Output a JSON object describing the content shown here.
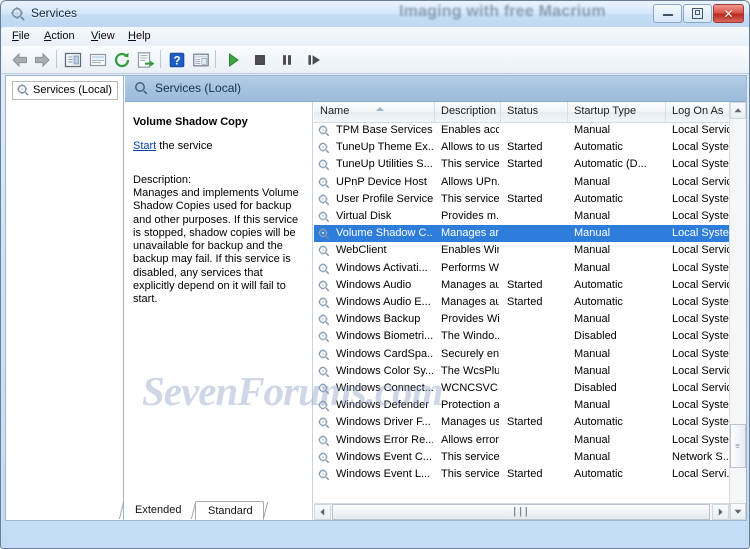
{
  "window": {
    "title": "Services",
    "title_icon": "services-gear-icon",
    "overlay_text": "Imaging with free Macrium",
    "watermark": "SevenForums.com",
    "controls": {
      "minimize": "minimize-button",
      "maximize": "maximize-button",
      "close": "close-button",
      "close_glyph": "✕"
    },
    "close_color": "#c43d2f",
    "accent_color": "#2f7ddb"
  },
  "menubar": {
    "items": [
      {
        "label": "File",
        "accel": "F"
      },
      {
        "label": "Action",
        "accel": "A"
      },
      {
        "label": "View",
        "accel": "V"
      },
      {
        "label": "Help",
        "accel": "H"
      }
    ]
  },
  "toolbar": {
    "buttons": [
      {
        "name": "back-button",
        "icon": "arrow-left-icon"
      },
      {
        "name": "forward-button",
        "icon": "arrow-right-icon"
      },
      {
        "name": "show-hide-tree-button",
        "icon": "tree-panel-icon"
      },
      {
        "name": "properties-button",
        "icon": "properties-icon"
      },
      {
        "name": "refresh-button",
        "icon": "refresh-icon"
      },
      {
        "name": "export-list-button",
        "icon": "export-icon"
      },
      {
        "name": "help-button",
        "icon": "question-mark-icon"
      },
      {
        "name": "new-window-button",
        "icon": "new-window-icon"
      },
      {
        "name": "start-service-button",
        "icon": "play-icon"
      },
      {
        "name": "stop-service-button",
        "icon": "stop-icon"
      },
      {
        "name": "pause-service-button",
        "icon": "pause-icon"
      },
      {
        "name": "restart-service-button",
        "icon": "restart-icon"
      }
    ]
  },
  "tree": {
    "root_label": "Services (Local)",
    "root_icon": "services-gear-icon"
  },
  "pane": {
    "header_label": "Services (Local)",
    "header_icon": "services-gear-icon"
  },
  "details": {
    "service_name": "Volume Shadow Copy",
    "action_link": "Start",
    "action_suffix": " the service",
    "description_label": "Description:",
    "description": "Manages and implements Volume Shadow Copies used for backup and other purposes. If this service is stopped, shadow copies will be unavailable for backup and the backup may fail. If this service is disabled, any services that explicitly depend on it will fail to start."
  },
  "list": {
    "columns": [
      {
        "label": "Name",
        "sorted": "asc"
      },
      {
        "label": "Description",
        "sorted": ""
      },
      {
        "label": "Status",
        "sorted": ""
      },
      {
        "label": "Startup Type",
        "sorted": ""
      },
      {
        "label": "Log On As",
        "sorted": ""
      }
    ],
    "rows": [
      {
        "name": "TPM Base Services",
        "description": "Enables acc...",
        "status": "",
        "startup": "Manual",
        "logon": "Local Service",
        "selected": false
      },
      {
        "name": "TuneUp Theme Ex...",
        "description": "Allows to us...",
        "status": "Started",
        "startup": "Automatic",
        "logon": "Local Syste...",
        "selected": false
      },
      {
        "name": "TuneUp Utilities S...",
        "description": "This service ...",
        "status": "Started",
        "startup": "Automatic (D...",
        "logon": "Local Syste...",
        "selected": false
      },
      {
        "name": "UPnP Device Host",
        "description": "Allows UPn...",
        "status": "",
        "startup": "Manual",
        "logon": "Local Service",
        "selected": false
      },
      {
        "name": "User Profile Service",
        "description": "This service ...",
        "status": "Started",
        "startup": "Automatic",
        "logon": "Local Syste...",
        "selected": false
      },
      {
        "name": "Virtual Disk",
        "description": "Provides m...",
        "status": "",
        "startup": "Manual",
        "logon": "Local Syste...",
        "selected": false
      },
      {
        "name": "Volume Shadow C...",
        "description": "Manages an...",
        "status": "",
        "startup": "Manual",
        "logon": "Local Syste...",
        "selected": true
      },
      {
        "name": "WebClient",
        "description": "Enables Win...",
        "status": "",
        "startup": "Manual",
        "logon": "Local Service",
        "selected": false
      },
      {
        "name": "Windows Activati...",
        "description": "Performs W...",
        "status": "",
        "startup": "Manual",
        "logon": "Local Syste...",
        "selected": false
      },
      {
        "name": "Windows Audio",
        "description": "Manages au...",
        "status": "Started",
        "startup": "Automatic",
        "logon": "Local Service",
        "selected": false
      },
      {
        "name": "Windows Audio E...",
        "description": "Manages au...",
        "status": "Started",
        "startup": "Automatic",
        "logon": "Local Syste...",
        "selected": false
      },
      {
        "name": "Windows Backup",
        "description": "Provides Wi...",
        "status": "",
        "startup": "Manual",
        "logon": "Local Syste...",
        "selected": false
      },
      {
        "name": "Windows Biometri...",
        "description": "The Windo...",
        "status": "",
        "startup": "Disabled",
        "logon": "Local Syste...",
        "selected": false
      },
      {
        "name": "Windows CardSpa...",
        "description": "Securely en...",
        "status": "",
        "startup": "Manual",
        "logon": "Local Syste...",
        "selected": false
      },
      {
        "name": "Windows Color Sy...",
        "description": "The WcsPlu...",
        "status": "",
        "startup": "Manual",
        "logon": "Local Service",
        "selected": false
      },
      {
        "name": "Windows Connect...",
        "description": "WCNCSVC ...",
        "status": "",
        "startup": "Disabled",
        "logon": "Local Service",
        "selected": false
      },
      {
        "name": "Windows Defender",
        "description": "Protection a...",
        "status": "",
        "startup": "Manual",
        "logon": "Local Syste...",
        "selected": false
      },
      {
        "name": "Windows Driver F...",
        "description": "Manages us...",
        "status": "Started",
        "startup": "Automatic",
        "logon": "Local Syste...",
        "selected": false
      },
      {
        "name": "Windows Error Re...",
        "description": "Allows error...",
        "status": "",
        "startup": "Manual",
        "logon": "Local Syste...",
        "selected": false
      },
      {
        "name": "Windows Event C...",
        "description": "This service ...",
        "status": "",
        "startup": "Manual",
        "logon": "Network S...",
        "selected": false
      },
      {
        "name": "Windows Event L...",
        "description": "This service ...",
        "status": "Started",
        "startup": "Automatic",
        "logon": "Local Servi...",
        "selected": false
      }
    ]
  },
  "tabs": [
    {
      "label": "Extended",
      "active": false
    },
    {
      "label": "Standard",
      "active": true
    }
  ]
}
